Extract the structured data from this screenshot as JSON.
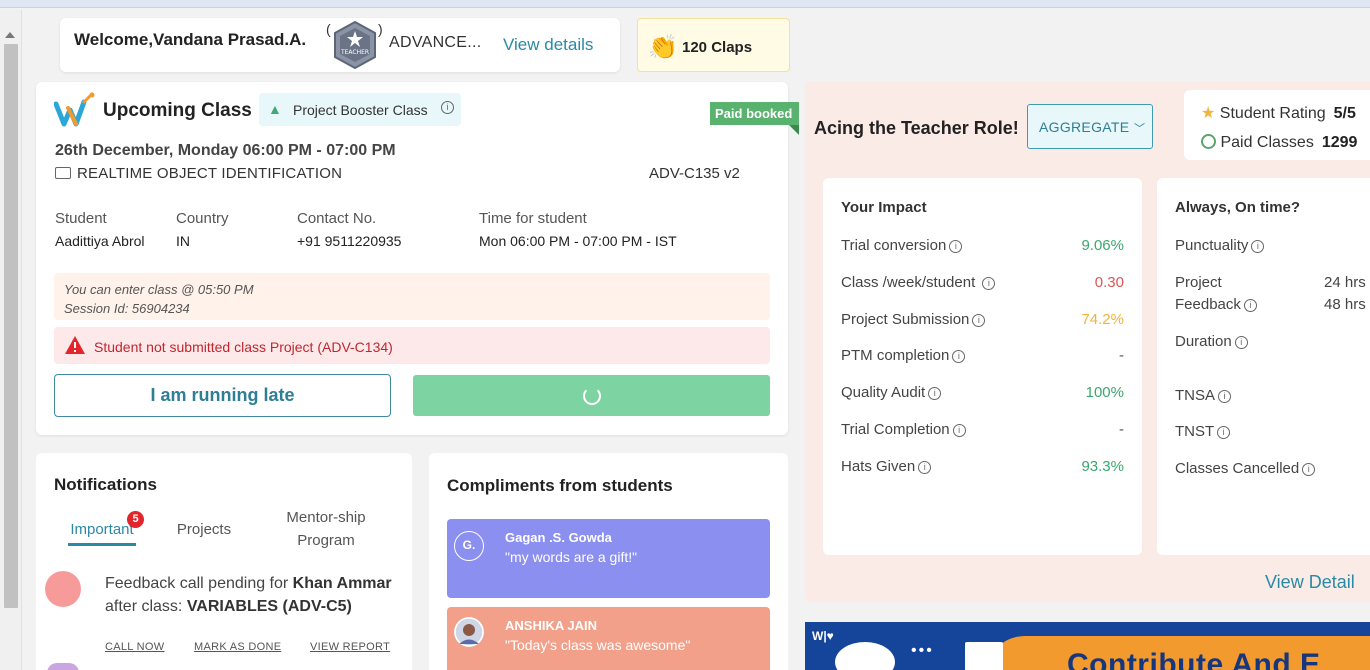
{
  "welcome": {
    "greeting": "Welcome,Vandana Prasad.A.",
    "badge_label": "TEACHER",
    "level": "ADVANCE...",
    "view_details": "View details"
  },
  "claps": {
    "label": "120 Claps"
  },
  "upcoming": {
    "title": "Upcoming Class",
    "class_type": "Project Booster Class",
    "status": "Paid booked",
    "datetime": "26th December, Monday 06:00 PM - 07:00 PM",
    "topic": "REALTIME OBJECT IDENTIFICATION",
    "code": "ADV-C135 v2",
    "details": [
      {
        "header": "Student",
        "value": "Aadittiya Abrol"
      },
      {
        "header": "Country",
        "value": "IN"
      },
      {
        "header": "Contact No.",
        "value": "+91 9511220935"
      },
      {
        "header": "Time for student",
        "value": "Mon 06:00 PM - 07:00 PM - IST"
      }
    ],
    "enter_note": "You can enter class @ 05:50 PM",
    "session": "Session Id: 56904234",
    "alert": "Student not submitted class Project (ADV-C134)",
    "late_button": "I am running late"
  },
  "notifications": {
    "title": "Notifications",
    "tabs": [
      {
        "label": "Important",
        "count": "5"
      },
      {
        "label": "Projects"
      },
      {
        "label_line1": "Mentor-ship",
        "label_line2": "Program"
      }
    ],
    "item": {
      "text_a": "Feedback call pending for ",
      "name": "Khan Ammar",
      "text_b": " after class: ",
      "class": "VARIABLES (ADV-C5)",
      "actions": [
        "CALL NOW",
        "MARK AS DONE",
        "VIEW REPORT"
      ]
    }
  },
  "compliments": {
    "title": "Compliments from students",
    "items": [
      {
        "initials": "G.",
        "name": "Gagan .S. Gowda",
        "quote": "\"my words are a gift!\"",
        "color": "#8b8ff0"
      },
      {
        "initials": "",
        "name": "ANSHIKA JAIN",
        "quote": "\"Today's class was awesome\"",
        "color": "#f2a08a"
      }
    ]
  },
  "teacher_role": {
    "heading": "Acing the Teacher Role!",
    "filter": "AGGREGATE",
    "rating_label": "Student Rating",
    "rating_value": "5/5",
    "paid_label": "Paid Classes",
    "paid_value": "1299",
    "impact": {
      "title": "Your Impact",
      "rows": [
        {
          "label": "Trial conversion",
          "value": "9.06%",
          "tone": "g"
        },
        {
          "label": "Class /week/student",
          "value": "0.30",
          "tone": "r"
        },
        {
          "label": "Project Submission",
          "value": "74.2%",
          "tone": "y"
        },
        {
          "label": "PTM completion",
          "value": "-",
          "tone": "k"
        },
        {
          "label": "Quality Audit",
          "value": "100%",
          "tone": "g"
        },
        {
          "label": "Trial Completion",
          "value": "-",
          "tone": "k"
        },
        {
          "label": "Hats Given",
          "value": "93.3%",
          "tone": "g"
        }
      ]
    },
    "ontime": {
      "title": "Always, On time?",
      "punctuality": "Punctuality",
      "project": "Project",
      "feedback": "Feedback",
      "project_val": "24 hrs",
      "feedback_val": "48 hrs",
      "duration": "Duration",
      "tnsa": "TNSA",
      "tnst": "TNST",
      "cancelled": "Classes Cancelled"
    },
    "view_detail": "View Detail"
  },
  "banner": {
    "logo": "W|♥",
    "text": "Contribute And E"
  },
  "colors": {
    "accent": "#2a8aa4",
    "success": "#3aa76d",
    "danger": "#c0272d",
    "warning": "#f0b43c"
  }
}
